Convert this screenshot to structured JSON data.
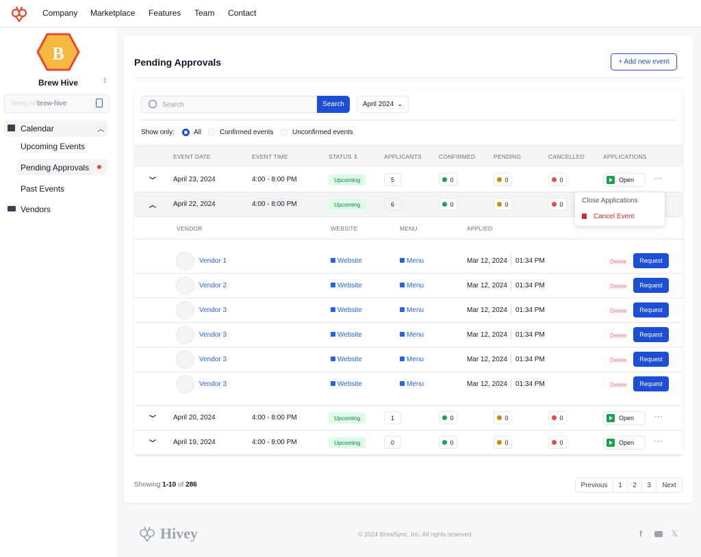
{
  "nav": {
    "items": [
      "Company",
      "Marketplace",
      "Features",
      "Team",
      "Contact"
    ]
  },
  "sidebar": {
    "org_name": "Brew Hive",
    "logo_letter": "B",
    "url_prefix": "hivey.io/",
    "url_slug": "brew-hive",
    "calendar": "Calendar",
    "sub_items": [
      "Upcoming Events",
      "Pending Approvals",
      "Past Events"
    ],
    "vendors": "Vendors"
  },
  "main": {
    "title": "Pending Approvals",
    "add_button": "+ Add new event",
    "search_placeholder": "Search",
    "search_button": "Search",
    "month": "April 2024",
    "show_only": "Show only:",
    "filters": [
      "All",
      "Confirmed events",
      "Unconfirmed events"
    ],
    "columns": [
      "EVENT DATE",
      "EVENT TIME",
      "STATUS",
      "APPLICANTS",
      "CONFIRMED",
      "PENDING",
      "CANCELLED",
      "APPLICATIONS"
    ],
    "events": [
      {
        "date": "April 23, 2024",
        "time": "4:00 - 8:00 PM",
        "status": "Upcoming",
        "applicants": "5",
        "confirmed": "0",
        "pending": "0",
        "cancelled": "0",
        "applications": "Open"
      },
      {
        "date": "April 22, 2024",
        "time": "4:00 - 8:00 PM",
        "status": "Upcoming",
        "applicants": "6",
        "confirmed": "0",
        "pending": "0",
        "cancelled": "0",
        "applications": ""
      },
      {
        "date": "April 20, 2024",
        "time": "4:00 - 8:00 PM",
        "status": "Upcoming",
        "applicants": "1",
        "confirmed": "0",
        "pending": "0",
        "cancelled": "0",
        "applications": "Open"
      },
      {
        "date": "April 19, 2024",
        "time": "4:00 - 8:00 PM",
        "status": "Upcoming",
        "applicants": "0",
        "confirmed": "0",
        "pending": "0",
        "cancelled": "0",
        "applications": "Open"
      }
    ],
    "dropdown": {
      "close": "Close Applications",
      "cancel": "Cancel Event"
    },
    "vendor_columns": [
      "VENDOR",
      "WEBSITE",
      "MENU",
      "APPLIED"
    ],
    "vendors": [
      {
        "name": "Vendor 1",
        "website": "Website",
        "menu": "Menu",
        "date": "Mar 12, 2024",
        "time": "01:34 PM",
        "delete": "Delete",
        "request": "Request"
      },
      {
        "name": "Vendor 2",
        "website": "Website",
        "menu": "Menu",
        "date": "Mar 12, 2024",
        "time": "01:34 PM",
        "delete": "Delete",
        "request": "Request"
      },
      {
        "name": "Vendor 3",
        "website": "Website",
        "menu": "Menu",
        "date": "Mar 12, 2024",
        "time": "01:34 PM",
        "delete": "Delete",
        "request": "Request"
      },
      {
        "name": "Vendor 3",
        "website": "Website",
        "menu": "Menu",
        "date": "Mar 12, 2024",
        "time": "01:34 PM",
        "delete": "Delete",
        "request": "Request"
      },
      {
        "name": "Vendor 3",
        "website": "Website",
        "menu": "Menu",
        "date": "Mar 12, 2024",
        "time": "01:34 PM",
        "delete": "Delete",
        "request": "Request"
      },
      {
        "name": "Vendor 3",
        "website": "Website",
        "menu": "Menu",
        "date": "Mar 12, 2024",
        "time": "01:34 PM",
        "delete": "Delete",
        "request": "Request"
      }
    ],
    "pagination": {
      "showing": "Showing",
      "range": "1-10",
      "of": "of",
      "total": "286",
      "prev": "Previous",
      "pages": [
        "1",
        "2",
        "3"
      ],
      "next": "Next"
    }
  },
  "footer": {
    "brand": "Hivey",
    "copyright": "© 2024 BrewSync, Inc. All rights reserved."
  },
  "colors": {
    "accent": "#1d4ed8",
    "brand": "#e8472a",
    "confirmed": "#16a34a",
    "pending": "#ca8a04",
    "cancelled": "#ef4444"
  }
}
